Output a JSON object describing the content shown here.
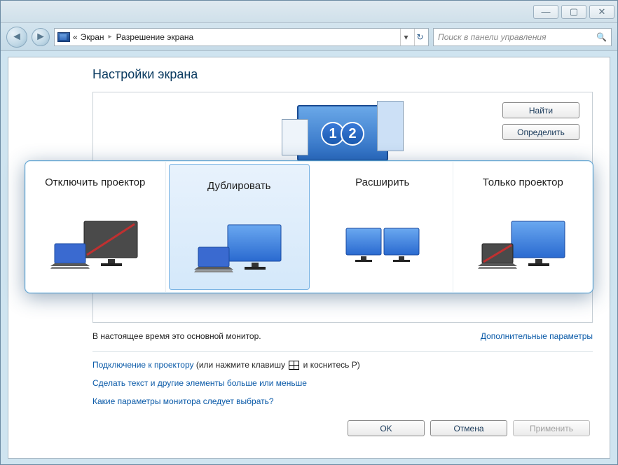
{
  "window_controls": {
    "min": "—",
    "max": "▢",
    "close": "✕"
  },
  "nav": {
    "back": "◄",
    "forward": "►"
  },
  "breadcrumb": {
    "back_chev": "«",
    "item1": "Экран",
    "sep": "▸",
    "item2": "Разрешение экрана",
    "dropdown": "▾",
    "refresh": "↻"
  },
  "search": {
    "placeholder": "Поиск в панели управления",
    "icon": "🔍"
  },
  "page": {
    "title": "Настройки экрана",
    "monitors": {
      "num1": "1",
      "num2": "2"
    },
    "side_buttons": {
      "find": "Найти",
      "identify": "Определить"
    },
    "info_text": "В настоящее время это основной монитор.",
    "adv_link": "Дополнительные параметры",
    "links": {
      "connect_projector_link": "Подключение к проектору",
      "connect_projector_tail": " (или нажмите клавишу ",
      "connect_projector_tail2": " и коснитесь P)",
      "text_size": "Сделать текст и другие элементы больше или меньше",
      "which_settings": "Какие параметры монитора следует выбрать?"
    },
    "footer": {
      "ok": "OK",
      "cancel": "Отмена",
      "apply": "Применить"
    }
  },
  "projector": {
    "options": [
      {
        "label": "Отключить проектор"
      },
      {
        "label": "Дублировать",
        "selected": true
      },
      {
        "label": "Расширить"
      },
      {
        "label": "Только проектор"
      }
    ]
  }
}
